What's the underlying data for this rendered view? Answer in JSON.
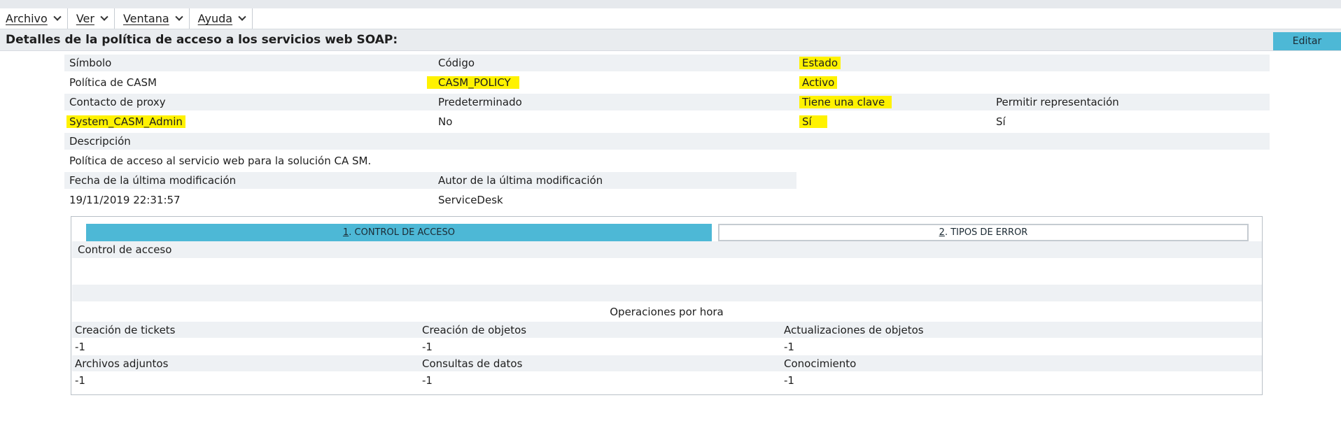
{
  "menu": {
    "items": [
      {
        "label": "Archivo"
      },
      {
        "label": "Ver"
      },
      {
        "label": "Ventana"
      },
      {
        "label": "Ayuda"
      }
    ]
  },
  "header": {
    "title": "Detalles de la política de acceso a los servicios web SOAP:",
    "edit_label": "Editar"
  },
  "details": {
    "simbolo_label": "Símbolo",
    "simbolo_value": "Política de CASM",
    "codigo_label": "Código",
    "codigo_value": "CASM_POLICY",
    "estado_label": "Estado",
    "estado_value": "Activo",
    "contacto_label": "Contacto de proxy",
    "contacto_value": "System_CASM_Admin",
    "predeterminado_label": "Predeterminado",
    "predeterminado_value": "No",
    "clave_label": "Tiene una clave",
    "clave_value": "Sí",
    "representacion_label": "Permitir representación",
    "representacion_value": "Sí",
    "descripcion_label": "Descripción",
    "descripcion_value": "Política de acceso al servicio web para la solución CA SM.",
    "fecha_label": "Fecha de la última modificación",
    "fecha_value": "19/11/2019 22:31:57",
    "autor_label": "Autor de la última modificación",
    "autor_value": "ServiceDesk"
  },
  "highlight_color": "#fff200",
  "accent_color": "#4db8d6",
  "tabs": [
    {
      "num": "1",
      "label": ". CONTROL DE ACCESO"
    },
    {
      "num": "2",
      "label": ". TIPOS DE ERROR"
    }
  ],
  "panel": {
    "section_title": "Control de acceso",
    "ops_title": "Operaciones por hora",
    "ops": [
      {
        "label": "Creación de tickets",
        "value": "-1"
      },
      {
        "label": "Creación de objetos",
        "value": "-1"
      },
      {
        "label": "Actualizaciones de objetos",
        "value": "-1"
      },
      {
        "label": "Archivos adjuntos",
        "value": "-1"
      },
      {
        "label": "Consultas de datos",
        "value": "-1"
      },
      {
        "label": "Conocimiento",
        "value": "-1"
      }
    ]
  }
}
